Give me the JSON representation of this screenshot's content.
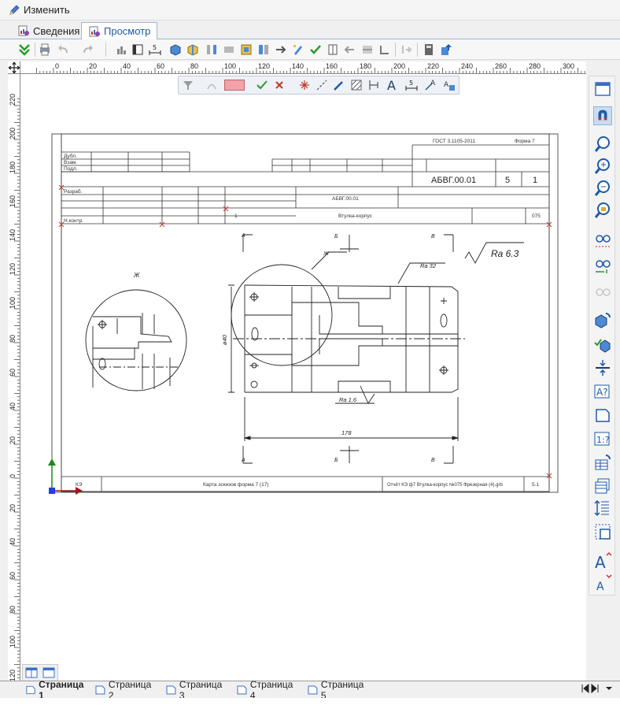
{
  "editbar": {
    "label": "Изменить"
  },
  "tabs": [
    {
      "label": "Сведения",
      "active": false
    },
    {
      "label": "Просмотр",
      "active": true
    }
  ],
  "ruler": {
    "h_labels": [
      "0",
      "20",
      "40",
      "60",
      "80",
      "100",
      "120",
      "140",
      "160",
      "180",
      "200",
      "220",
      "240",
      "260",
      "280",
      "300"
    ],
    "v_labels": [
      "220",
      "200",
      "180",
      "160",
      "140",
      "120",
      "100",
      "80",
      "60",
      "40",
      "20",
      "0",
      "20",
      "40",
      "60",
      "80",
      "100",
      "120"
    ]
  },
  "drawing": {
    "stamp_top": {
      "gost": "ГОСТ 3.1105-2011",
      "form": "Форма 7"
    },
    "left_labels": [
      "Дубл.",
      "Взам.",
      "Подл."
    ],
    "doc_code": "АБВГ.00.01",
    "sheet_count": "5",
    "sheet_no": "1",
    "razrab": "Разраб.",
    "nkontr": "Н.контр.",
    "doc_code_small": "АБВГ.00.01",
    "row_no": "1",
    "part_name": "Втулка-корпус",
    "op_no": "075",
    "roughness_main": "Ra 6.3",
    "roughness_a": "Ra 32",
    "roughness_b": "Ra 1.6",
    "dim_len": "178",
    "dim_dia": "ø40",
    "view_j": "Ж",
    "view_j2": "Ж",
    "sec_a": "А",
    "sec_b": "Б",
    "sec_v": "В",
    "footer_left": "КЭ",
    "footer_mid": "Карта эскизов форма 7 (17)",
    "footer_right": "Отчёт КЭ ф7 Втулка-корпус №075 Фрезерная (4).grb",
    "footer_sheet": "5.1"
  },
  "pages": [
    {
      "label": "Страница 1",
      "active": true
    },
    {
      "label": "Страница 2",
      "active": false
    },
    {
      "label": "Страница 3",
      "active": false
    },
    {
      "label": "Страница 4",
      "active": false
    },
    {
      "label": "Страница 5",
      "active": false
    }
  ],
  "colors": {
    "accent": "#1e5aa8",
    "axis_y": "#1a8a1a",
    "axis_x": "#9b1b1b",
    "snap": "#c0392b"
  }
}
